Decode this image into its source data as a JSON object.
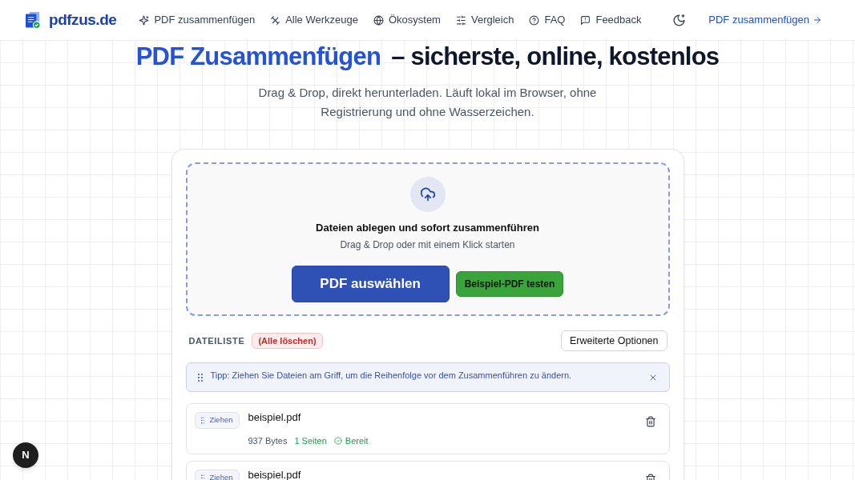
{
  "header": {
    "logo_text": "pdfzus.de",
    "nav": [
      {
        "label": "PDF zusammenfügen"
      },
      {
        "label": "Alle Werkzeuge"
      },
      {
        "label": "Ökosystem"
      },
      {
        "label": "Vergleich"
      },
      {
        "label": "FAQ"
      },
      {
        "label": "Feedback"
      }
    ],
    "cta": "PDF zusammenfügen"
  },
  "hero": {
    "title_highlight": "PDF Zusammenfügen",
    "title_rest": "– sicherste, online, kostenlos",
    "subtitle": "Drag & Drop, direkt herunterladen. Läuft lokal im Browser, ohne Registrierung und ohne Wasserzeichen."
  },
  "dropzone": {
    "heading": "Dateien ablegen und sofort zusammenführen",
    "hint": "Drag & Drop oder mit einem Klick starten",
    "primary_button": "PDF auswählen",
    "secondary_button": "Beispiel-PDF testen"
  },
  "file_list": {
    "label": "DATEILISTE",
    "clear_button": "(Alle löschen)",
    "options_button": "Erweiterte Optionen",
    "tip": "Tipp: Ziehen Sie Dateien am Griff, um die Reihenfolge vor dem Zusammenführen zu ändern.",
    "files": [
      {
        "handle": "Ziehen",
        "name": "beispiel.pdf",
        "size": "937 Bytes",
        "pages": "1 Seiten",
        "status": "Bereit"
      },
      {
        "handle": "Ziehen",
        "name": "beispiel.pdf"
      }
    ]
  },
  "dev_badge": "N"
}
